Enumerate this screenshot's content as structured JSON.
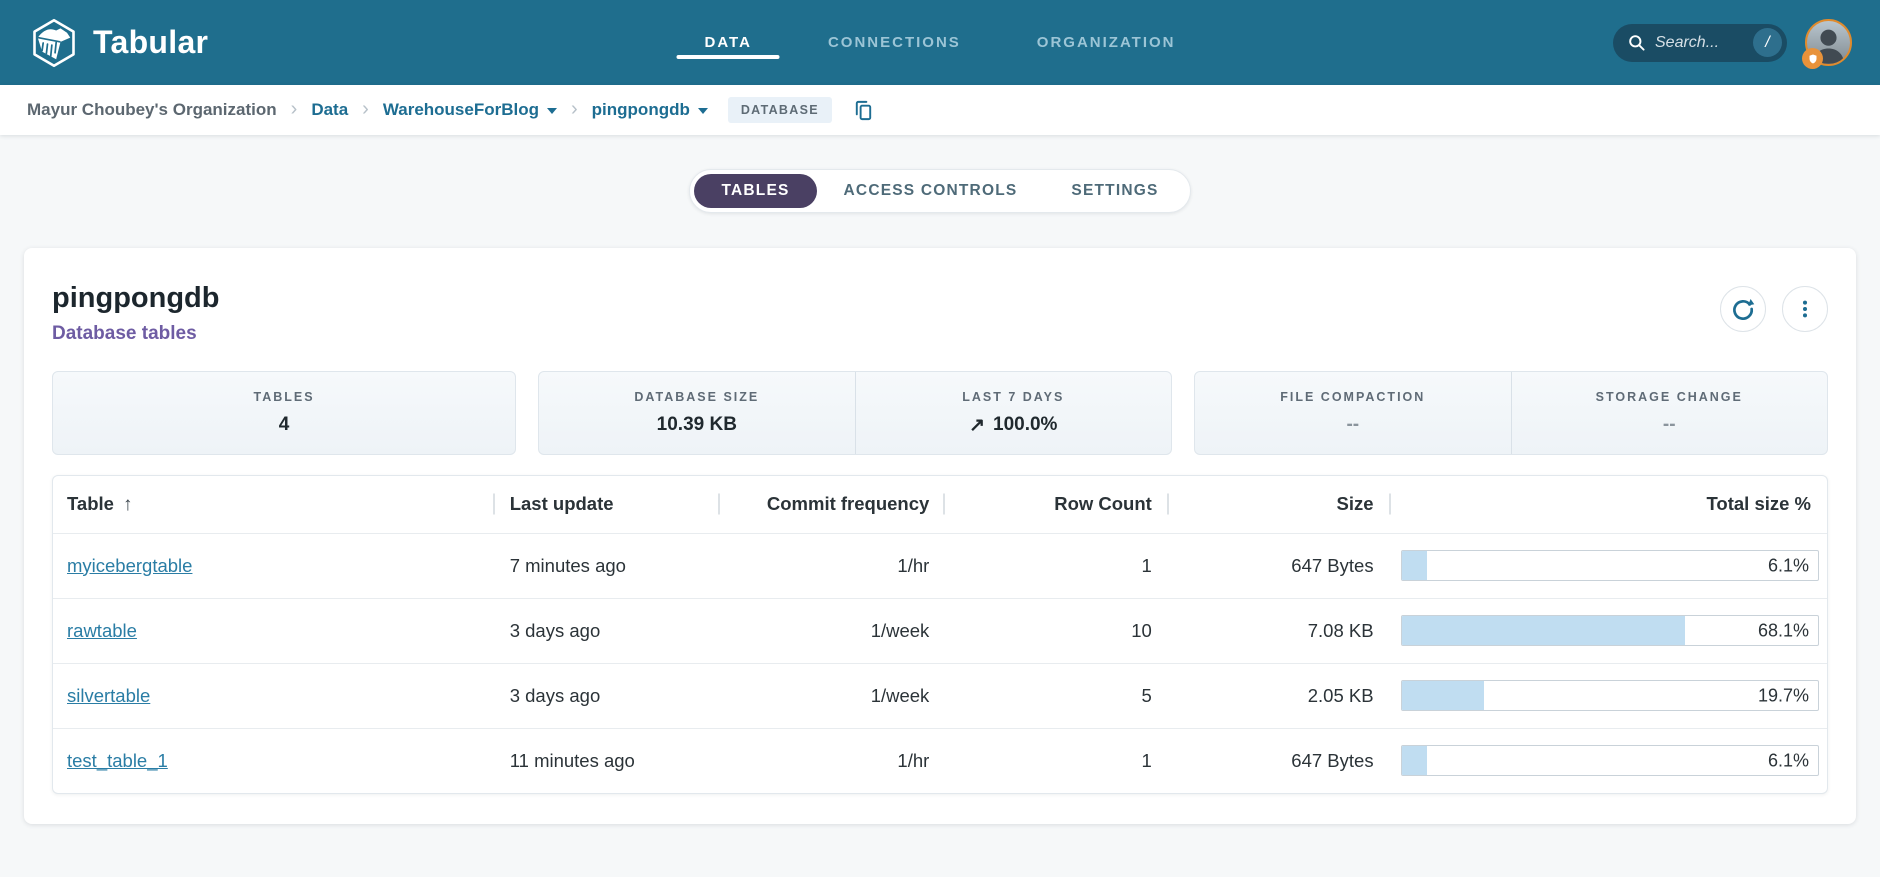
{
  "topbar": {
    "brand": "Tabular",
    "nav": [
      {
        "label": "DATA",
        "active": true
      },
      {
        "label": "CONNECTIONS",
        "active": false
      },
      {
        "label": "ORGANIZATION",
        "active": false
      }
    ],
    "search": {
      "placeholder": "Search...",
      "shortcut": "/"
    }
  },
  "breadcrumb": {
    "org": "Mayur Choubey's Organization",
    "section": "Data",
    "warehouse": "WarehouseForBlog",
    "database": "pingpongdb",
    "badge": "DATABASE"
  },
  "tabs": [
    {
      "label": "TABLES",
      "active": true
    },
    {
      "label": "ACCESS CONTROLS",
      "active": false
    },
    {
      "label": "SETTINGS",
      "active": false
    }
  ],
  "page": {
    "title": "pingpongdb",
    "subtitle": "Database tables"
  },
  "stats": {
    "tables": {
      "label": "TABLES",
      "value": "4"
    },
    "database_size": {
      "label": "DATABASE SIZE",
      "value": "10.39 KB"
    },
    "last_7_days": {
      "label": "LAST 7 DAYS",
      "trend_arrow": "↗",
      "value": "100.0%"
    },
    "file_compaction": {
      "label": "FILE COMPACTION",
      "value": "--"
    },
    "storage_change": {
      "label": "STORAGE CHANGE",
      "value": "--"
    }
  },
  "table": {
    "columns": [
      "Table",
      "Last update",
      "Commit frequency",
      "Row Count",
      "Size",
      "Total size %"
    ],
    "sort": {
      "column": "Table",
      "direction": "asc",
      "arrow": "↑"
    },
    "rows": [
      {
        "name": "myicebergtable",
        "last_update": "7 minutes ago",
        "commit_frequency": "1/hr",
        "row_count": "1",
        "size": "647 Bytes",
        "total_size_pct": 6.1,
        "total_size_label": "6.1%"
      },
      {
        "name": "rawtable",
        "last_update": "3 days ago",
        "commit_frequency": "1/week",
        "row_count": "10",
        "size": "7.08 KB",
        "total_size_pct": 68.1,
        "total_size_label": "68.1%"
      },
      {
        "name": "silvertable",
        "last_update": "3 days ago",
        "commit_frequency": "1/week",
        "row_count": "5",
        "size": "2.05 KB",
        "total_size_pct": 19.7,
        "total_size_label": "19.7%"
      },
      {
        "name": "test_table_1",
        "last_update": "11 minutes ago",
        "commit_frequency": "1/hr",
        "row_count": "1",
        "size": "647 Bytes",
        "total_size_pct": 6.1,
        "total_size_label": "6.1%"
      }
    ]
  },
  "colors": {
    "topbar": "#1f6e8d",
    "active_pill": "#4a4063",
    "link": "#2a7da5",
    "subtitle_purple": "#6e5ca3",
    "bar_fill": "#c0ddf1",
    "avatar_ring": "#e08b2d"
  }
}
